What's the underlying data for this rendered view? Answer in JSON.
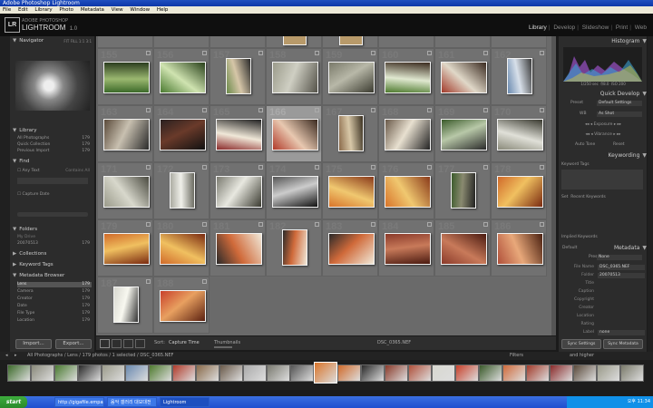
{
  "window": {
    "title": "Adobe Photoshop Lightroom"
  },
  "menu": [
    "File",
    "Edit",
    "Library",
    "Photo",
    "Metadata",
    "View",
    "Window",
    "Help"
  ],
  "header": {
    "logo_mark": "LR",
    "logo_sub": "ADOBE PHOTOSHOP",
    "logo_main": "LIGHTROOM",
    "version": "1.0",
    "modules": [
      "Library",
      "Develop",
      "Slideshow",
      "Print",
      "Web"
    ],
    "active_module": "Library"
  },
  "left_panel": {
    "navigator": {
      "title": "Navigator",
      "zoom": [
        "FIT",
        "FILL",
        "1:1",
        "3:1"
      ]
    },
    "library": {
      "title": "Library",
      "items": [
        {
          "label": "All Photographs",
          "count": "179"
        },
        {
          "label": "Quick Collection",
          "count": "179"
        },
        {
          "label": "Previous Import",
          "count": "179"
        }
      ]
    },
    "find": {
      "title": "Find",
      "any_text": "Any Text",
      "contains": "Contains All",
      "capture_date": "Capture Date"
    },
    "folders": {
      "title": "Folders",
      "items": [
        {
          "label": "My Drive",
          "count": ""
        },
        {
          "label": "20070513",
          "count": "179"
        }
      ]
    },
    "collections": {
      "title": "Collections"
    },
    "keyword_tags": {
      "title": "Keyword Tags"
    },
    "metadata_browser": {
      "title": "Metadata Browser",
      "items": [
        {
          "label": "Lens",
          "count": "179"
        },
        {
          "label": "Camera",
          "count": "179"
        },
        {
          "label": "Creator",
          "count": "179"
        },
        {
          "label": "Date",
          "count": "179"
        },
        {
          "label": "File Type",
          "count": "179"
        },
        {
          "label": "Location",
          "count": "179"
        }
      ]
    },
    "import_button": "Import...",
    "export_button": "Export..."
  },
  "grid": {
    "cells": [
      {
        "num": "155",
        "scene": "park"
      },
      {
        "num": "156",
        "scene": "tree"
      },
      {
        "num": "157",
        "scene": "portrait"
      },
      {
        "num": "158",
        "scene": "building"
      },
      {
        "num": "159",
        "scene": "wall"
      },
      {
        "num": "160",
        "scene": "garden"
      },
      {
        "num": "161",
        "scene": "temple"
      },
      {
        "num": "162",
        "scene": "sky"
      },
      {
        "num": "163",
        "scene": "roof"
      },
      {
        "num": "164",
        "scene": "dark"
      },
      {
        "num": "165",
        "scene": "doorway"
      },
      {
        "num": "166",
        "scene": "redgate"
      },
      {
        "num": "167",
        "scene": "courtyard"
      },
      {
        "num": "168",
        "scene": "fisheye"
      },
      {
        "num": "169",
        "scene": "lamp"
      },
      {
        "num": "170",
        "scene": "street"
      },
      {
        "num": "171",
        "scene": "houses"
      },
      {
        "num": "172",
        "scene": "umbrella"
      },
      {
        "num": "173",
        "scene": "canopy"
      },
      {
        "num": "174",
        "scene": "fork"
      },
      {
        "num": "175",
        "scene": "salad"
      },
      {
        "num": "176",
        "scene": "salad"
      },
      {
        "num": "177",
        "scene": "ground"
      },
      {
        "num": "178",
        "scene": "pasta"
      },
      {
        "num": "179",
        "scene": "pasta"
      },
      {
        "num": "180",
        "scene": "pasta"
      },
      {
        "num": "181",
        "scene": "mussels"
      },
      {
        "num": "182",
        "scene": "mussels"
      },
      {
        "num": "183",
        "scene": "mussels"
      },
      {
        "num": "184",
        "scene": "brick"
      },
      {
        "num": "185",
        "scene": "brick"
      },
      {
        "num": "186",
        "scene": "door"
      },
      {
        "num": "187",
        "scene": "sign"
      },
      {
        "num": "188",
        "scene": "pizza"
      }
    ],
    "selected_num": "166"
  },
  "toolbar": {
    "sort_label": "Sort:",
    "sort_value": "Capture Time",
    "thumbnails_label": "Thumbnails",
    "filename": "DSC_0365.NEF"
  },
  "right_panel": {
    "histogram": {
      "title": "Histogram",
      "info": [
        "1/250 sec",
        "f/8.0",
        "ISO 200"
      ]
    },
    "quick_develop": {
      "title": "Quick Develop",
      "preset_label": "Preset",
      "preset_value": "Default Settings",
      "wb_label": "WB",
      "wb_value": "As Shot",
      "exposure": "Exposure",
      "vibrance": "Vibrance",
      "auto_tone": "Auto Tone",
      "reset": "Reset"
    },
    "keywording": {
      "title": "Keywording",
      "keyword_tags": "Keyword Tags",
      "set_label": "Set",
      "set_value": "Recent Keywords",
      "implied": "Implied Keywords"
    },
    "metadata": {
      "title": "Metadata",
      "view": "Default",
      "preset_label": "Preset",
      "preset_value": "None",
      "fields": [
        {
          "label": "File Name",
          "value": "DSC_0365.NEF"
        },
        {
          "label": "Folder",
          "value": "20070513"
        },
        {
          "label": "Title",
          "value": ""
        },
        {
          "label": "Caption",
          "value": ""
        },
        {
          "label": "Copyright",
          "value": ""
        },
        {
          "label": "Creator",
          "value": ""
        },
        {
          "label": "Location",
          "value": ""
        },
        {
          "label": "Rating",
          "value": ""
        },
        {
          "label": "Label",
          "value": "none"
        }
      ]
    },
    "sync_settings": "Sync Settings",
    "sync_metadata": "Sync Metadata"
  },
  "filmstrip": {
    "path": "All Photographs / Lens / 179 photos / 1 selected / DSC_0365.NEF",
    "filters_label": "Filters",
    "filters_value": "and higher"
  },
  "taskbar": {
    "start": "start",
    "tasks": [
      "http://gigafile.empas.com...",
      "음악 갤러리 대모대전",
      "Lightroom"
    ],
    "tray_time": "오후 11:34"
  },
  "colors": {
    "accent": "#ddd",
    "grid_bg": "#6a6a6a",
    "selection": "#9a9a9a"
  }
}
